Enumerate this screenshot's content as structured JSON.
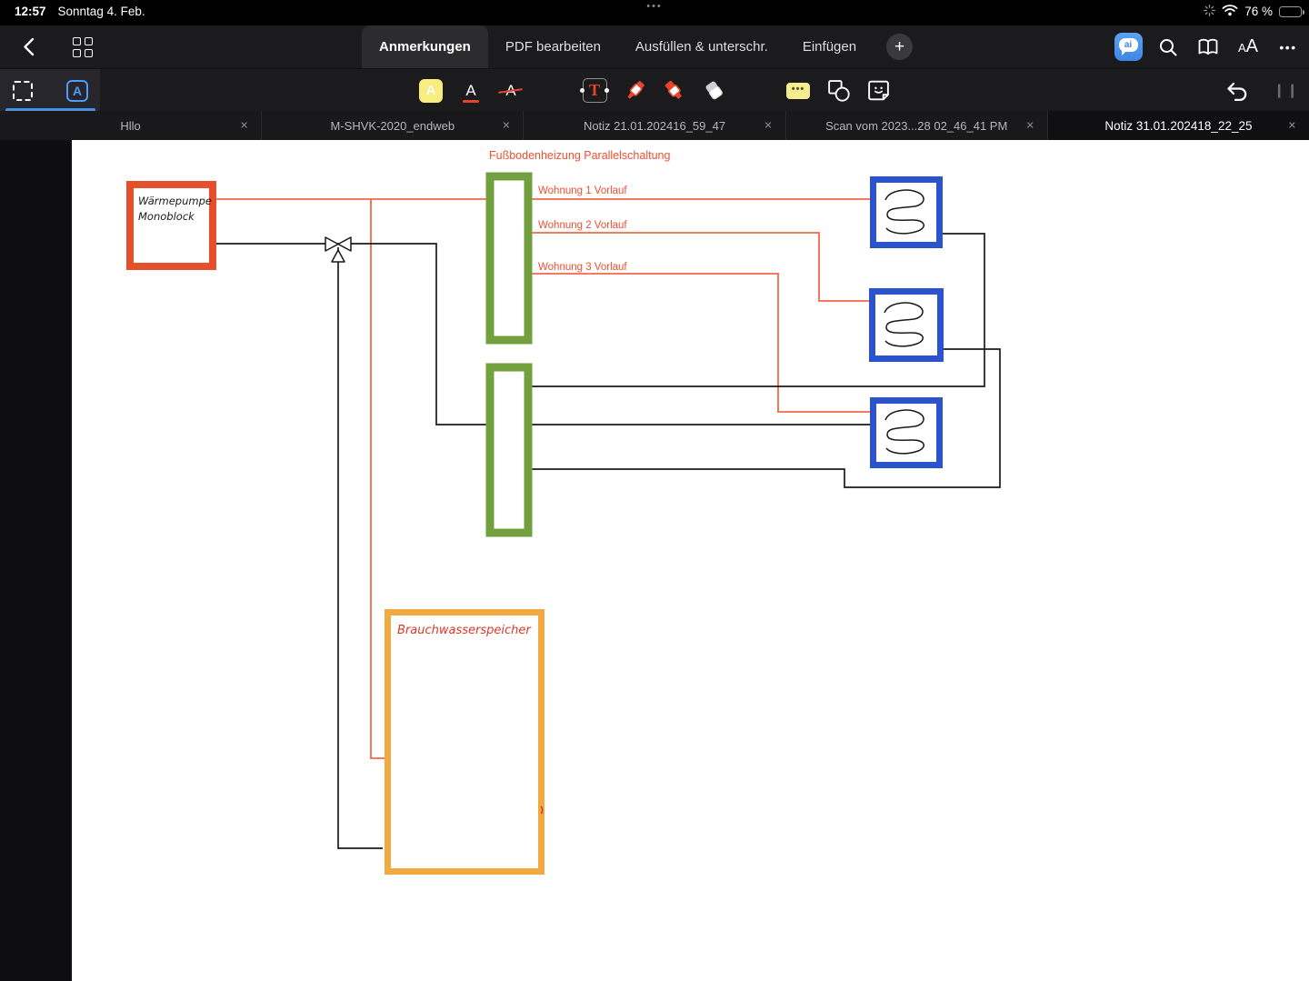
{
  "status_bar": {
    "time": "12:57",
    "date": "Sonntag 4. Feb.",
    "battery": "76 %",
    "battery_percent": 76,
    "multitask_dots": "•••"
  },
  "nav": {
    "tabs": [
      "Anmerkungen",
      "PDF bearbeiten",
      "Ausfüllen & unterschr.",
      "Einfügen"
    ],
    "active_tab": "Anmerkungen",
    "plus": "+",
    "ai_label": "ai",
    "text_size_small": "A",
    "text_size_large": "A",
    "more": "•••"
  },
  "tools": {
    "selected_tool": "text-annotation",
    "abox_letter": "A",
    "highlight_letter": "A",
    "underline_letter": "A",
    "strikethrough_letter": "A",
    "text_tool_letter": "T",
    "comment_dots": "•••",
    "pause_handle": "❙❙"
  },
  "doc_tabs": [
    "Hllo",
    "M-SHVK-2020_endweb",
    "Notiz 21.01.202416_59_47",
    "Scan vom 2023...28 02_46_41 PM",
    "Notiz 31.01.202418_22_25"
  ],
  "active_doc_tab": "Notiz 31.01.202418_22_25",
  "close_glyph": "✕",
  "diagram": {
    "title": "Fußbodenheizung Parallelschaltung",
    "heat_pump_line1": "Wärmepumpe",
    "heat_pump_line2": "Monoblock",
    "supply_labels": [
      "Wohnung 1 Vorlauf",
      "Wohnung 2 Vorlauf",
      "Wohnung 3 Vorlauf"
    ],
    "tank_label": "Brauchwasserspeicher",
    "colors": {
      "heat_pump_border": "#e64f2c",
      "supply_line": "#f2674b",
      "label_text": "#f04f30",
      "manifold_green": "#73a03e",
      "coil_blue": "#2a53cd",
      "tank_orange": "#f2a93f",
      "handwriting_red": "#d93a28",
      "return_line": "#1a1a1a"
    }
  }
}
